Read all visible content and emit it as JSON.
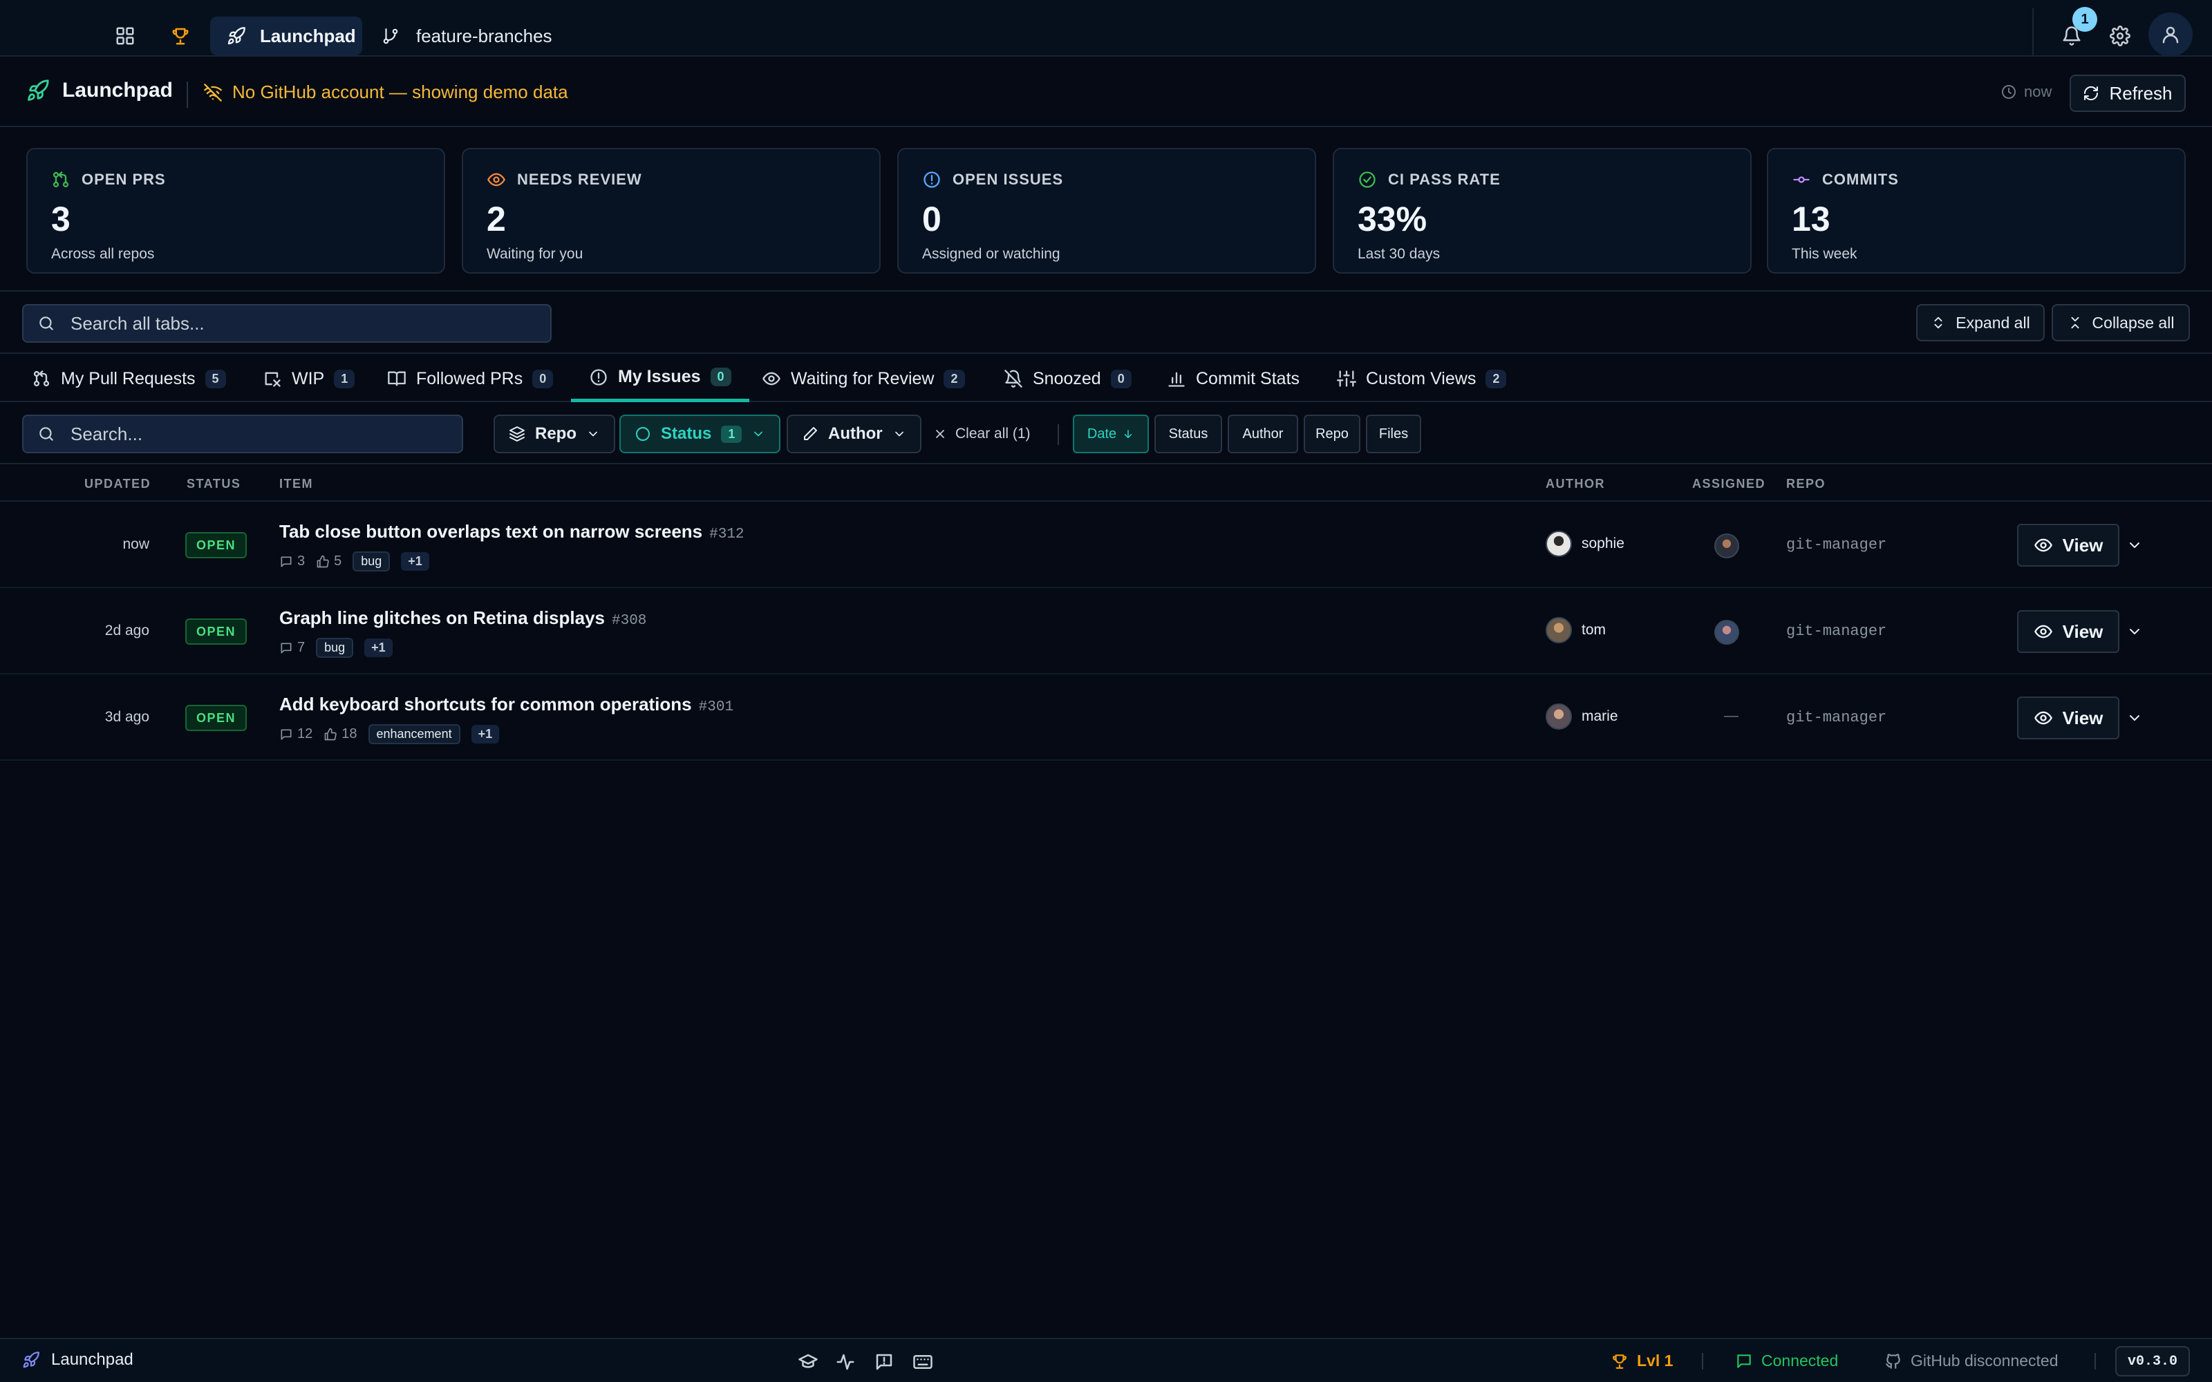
{
  "topbar": {
    "tabs": [
      {
        "label": "Launchpad",
        "icon": "rocket-icon",
        "active": true
      },
      {
        "label": "feature-branches",
        "icon": "git-branch-icon",
        "active": false
      }
    ],
    "notification_count": "1"
  },
  "header": {
    "title": "Launchpad",
    "warning": "No GitHub account — showing demo data",
    "last_updated": "now",
    "refresh_label": "Refresh"
  },
  "stats": [
    {
      "label": "OPEN PRS",
      "value": "3",
      "sub": "Across all repos",
      "icon": "git-pull-request-icon",
      "color": "#3fb950"
    },
    {
      "label": "NEEDS REVIEW",
      "value": "2",
      "sub": "Waiting for you",
      "icon": "eye-icon",
      "color": "#f0883e"
    },
    {
      "label": "OPEN ISSUES",
      "value": "0",
      "sub": "Assigned or watching",
      "icon": "issue-icon",
      "color": "#58a6ff"
    },
    {
      "label": "CI PASS RATE",
      "value": "33%",
      "sub": "Last 30 days",
      "icon": "check-circle-icon",
      "color": "#3fb950"
    },
    {
      "label": "COMMITS",
      "value": "13",
      "sub": "This week",
      "icon": "git-commit-icon",
      "color": "#bc8cff"
    }
  ],
  "global_search": {
    "placeholder": "Search all tabs..."
  },
  "expand_all_label": "Expand all",
  "collapse_all_label": "Collapse all",
  "tabs": [
    {
      "label": "My Pull Requests",
      "count": "5",
      "icon": "git-pull-request-icon"
    },
    {
      "label": "WIP",
      "count": "1",
      "icon": "wip-icon"
    },
    {
      "label": "Followed PRs",
      "count": "0",
      "icon": "book-icon"
    },
    {
      "label": "My Issues",
      "count": "0",
      "icon": "issue-icon",
      "active": true
    },
    {
      "label": "Waiting for Review",
      "count": "2",
      "icon": "eye-icon"
    },
    {
      "label": "Snoozed",
      "count": "0",
      "icon": "bell-off-icon"
    },
    {
      "label": "Commit Stats",
      "count": "",
      "icon": "bar-chart-icon"
    },
    {
      "label": "Custom Views",
      "count": "2",
      "icon": "sliders-icon"
    }
  ],
  "filters": {
    "search_placeholder": "Search...",
    "repo_label": "Repo",
    "status_label": "Status",
    "status_count": "1",
    "author_label": "Author",
    "clear_all_label": "Clear all (1)",
    "sort_buttons": [
      {
        "label": "Date",
        "active": true
      },
      {
        "label": "Status",
        "active": false
      },
      {
        "label": "Author",
        "active": false
      },
      {
        "label": "Repo",
        "active": false
      },
      {
        "label": "Files",
        "active": false
      }
    ]
  },
  "table": {
    "headers": {
      "updated": "UPDATED",
      "status": "STATUS",
      "item": "ITEM",
      "author": "AUTHOR",
      "assigned": "ASSIGNED",
      "repo": "REPO"
    },
    "rows": [
      {
        "updated": "now",
        "status": "OPEN",
        "title": "Tab close button overlaps text on narrow screens",
        "number": "#312",
        "comments": "3",
        "likes": "5",
        "labels": [
          "bug"
        ],
        "more": "+1",
        "author": "sophie",
        "assigned": true,
        "repo": "git-manager",
        "view": "View"
      },
      {
        "updated": "2d ago",
        "status": "OPEN",
        "title": "Graph line glitches on Retina displays",
        "number": "#308",
        "comments": "7",
        "likes": "",
        "labels": [
          "bug"
        ],
        "more": "+1",
        "author": "tom",
        "assigned": true,
        "repo": "git-manager",
        "view": "View"
      },
      {
        "updated": "3d ago",
        "status": "OPEN",
        "title": "Add keyboard shortcuts for common operations",
        "number": "#301",
        "comments": "12",
        "likes": "18",
        "labels": [
          "enhancement"
        ],
        "more": "+1",
        "author": "marie",
        "assigned": false,
        "assigned_placeholder": "—",
        "repo": "git-manager",
        "view": "View"
      }
    ]
  },
  "footer": {
    "brand": "Launchpad",
    "level": "Lvl 1",
    "connection": "Connected",
    "github": "GitHub disconnected",
    "version": "v0.3.0"
  },
  "colors": {
    "background": "#050a14",
    "accent_teal": "#14b8a6",
    "warning": "#f5b939",
    "success": "#4ade80"
  }
}
